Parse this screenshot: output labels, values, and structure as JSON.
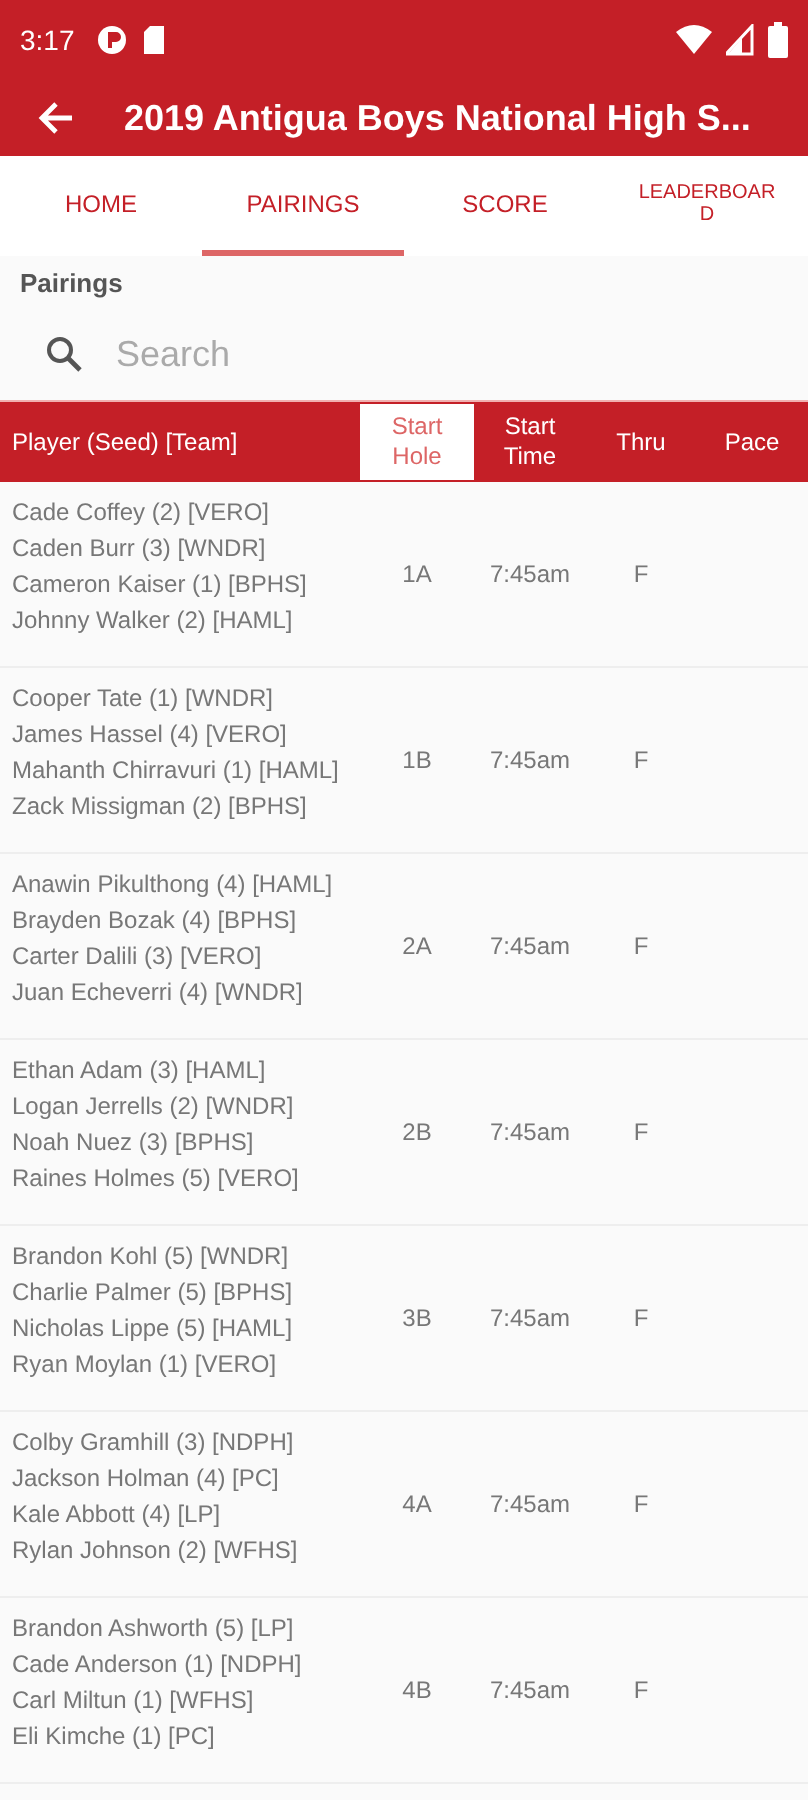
{
  "status_bar": {
    "time": "3:17"
  },
  "app_bar": {
    "title": "2019 Antigua Boys National High S..."
  },
  "tabs": [
    {
      "label": "HOME",
      "selected": false
    },
    {
      "label": "PAIRINGS",
      "selected": true
    },
    {
      "label": "SCORE",
      "selected": false
    },
    {
      "label": "LEADERBOARD",
      "selected": false
    }
  ],
  "section_title": "Pairings",
  "search": {
    "placeholder": "Search"
  },
  "table": {
    "columns": [
      {
        "label": "Player (Seed) [Team]",
        "selected": false
      },
      {
        "label": "Start Hole",
        "selected": true
      },
      {
        "label": "Start Time",
        "selected": false
      },
      {
        "label": "Thru",
        "selected": false
      },
      {
        "label": "Pace",
        "selected": false
      }
    ],
    "rows": [
      {
        "players": [
          "Cade Coffey (2) [VERO]",
          "Caden Burr (3) [WNDR]",
          "Cameron Kaiser (1) [BPHS]",
          "Johnny Walker (2) [HAML]"
        ],
        "start_hole": "1A",
        "start_time": "7:45am",
        "thru": "F"
      },
      {
        "players": [
          "Cooper Tate (1) [WNDR]",
          "James Hassel (4) [VERO]",
          "Mahanth Chirravuri (1) [HAML]",
          "Zack Missigman (2) [BPHS]"
        ],
        "start_hole": "1B",
        "start_time": "7:45am",
        "thru": "F"
      },
      {
        "players": [
          "Anawin Pikulthong (4) [HAML]",
          "Brayden Bozak (4) [BPHS]",
          "Carter Dalili (3) [VERO]",
          "Juan Echeverri (4) [WNDR]"
        ],
        "start_hole": "2A",
        "start_time": "7:45am",
        "thru": "F"
      },
      {
        "players": [
          "Ethan Adam (3) [HAML]",
          "Logan Jerrells (2) [WNDR]",
          "Noah Nuez (3) [BPHS]",
          "Raines Holmes (5) [VERO]"
        ],
        "start_hole": "2B",
        "start_time": "7:45am",
        "thru": "F"
      },
      {
        "players": [
          "Brandon Kohl (5) [WNDR]",
          "Charlie Palmer (5) [BPHS]",
          "Nicholas Lippe (5) [HAML]",
          "Ryan Moylan (1) [VERO]"
        ],
        "start_hole": "3B",
        "start_time": "7:45am",
        "thru": "F"
      },
      {
        "players": [
          "Colby Gramhill (3) [NDPH]",
          "Jackson Holman (4) [PC]",
          "Kale Abbott (4) [LP]",
          "Rylan Johnson (2) [WFHS]"
        ],
        "start_hole": "4A",
        "start_time": "7:45am",
        "thru": "F"
      },
      {
        "players": [
          "Brandon Ashworth (5) [LP]",
          "Cade Anderson (1) [NDPH]",
          "Carl Miltun (1) [WFHS]",
          "Eli Kimche (1) [PC]"
        ],
        "start_hole": "4B",
        "start_time": "7:45am",
        "thru": "F"
      }
    ]
  }
}
